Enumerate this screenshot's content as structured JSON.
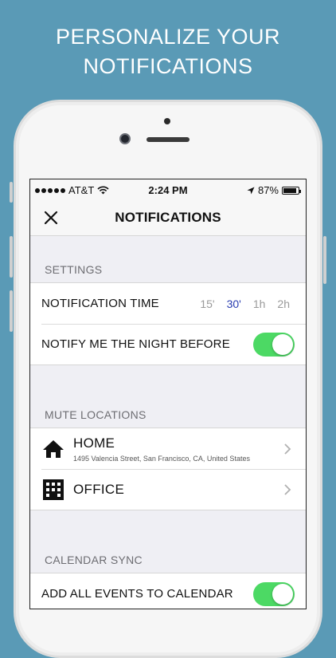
{
  "headline": {
    "line1": "PERSONALIZE YOUR",
    "line2": "NOTIFICATIONS"
  },
  "status_bar": {
    "carrier": "AT&T",
    "time": "2:24 PM",
    "battery": "87%",
    "battery_level": 0.87
  },
  "nav": {
    "title": "NOTIFICATIONS",
    "close_icon": "close-icon"
  },
  "settings": {
    "header": "SETTINGS",
    "notification_time": {
      "label": "NOTIFICATION TIME",
      "options": [
        "15'",
        "30'",
        "1h",
        "2h"
      ],
      "selected": "30'"
    },
    "night_before": {
      "label": "NOTIFY ME THE NIGHT BEFORE",
      "enabled": true
    }
  },
  "mute_locations": {
    "header": "MUTE LOCATIONS",
    "items": [
      {
        "name": "HOME",
        "address": "1495 Valencia Street, San Francisco, CA, United States",
        "icon": "home-icon"
      },
      {
        "name": "OFFICE",
        "address": "",
        "icon": "building-icon"
      }
    ]
  },
  "calendar_sync": {
    "header": "CALENDAR SYNC",
    "add_all": {
      "label": "ADD ALL EVENTS TO CALENDAR",
      "enabled": true
    }
  },
  "colors": {
    "background": "#5a9ab6",
    "toggle_on": "#4cd964",
    "selected_time": "#2a3db0"
  }
}
